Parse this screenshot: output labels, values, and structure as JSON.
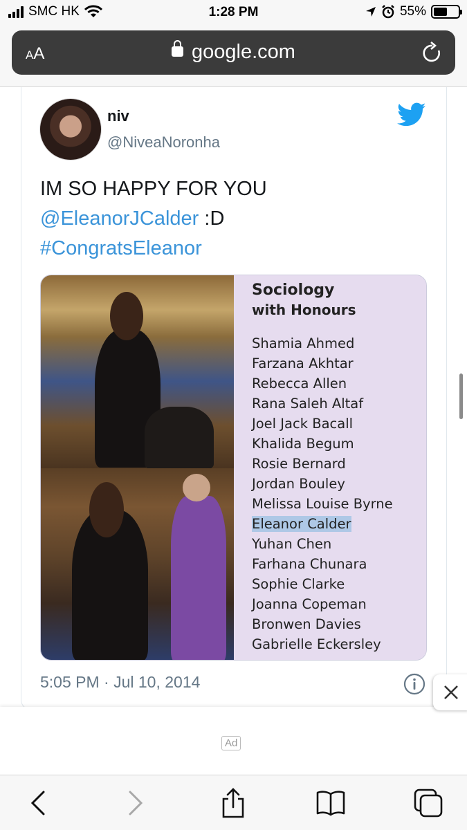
{
  "status_bar": {
    "carrier": "SMC HK",
    "time": "1:28 PM",
    "battery": "55%",
    "battery_level": 0.55,
    "icons": [
      "signal-icon",
      "wifi-icon",
      "location-arrow-icon",
      "alarm-icon",
      "battery-icon"
    ]
  },
  "browser": {
    "text_size_label": "AA",
    "url": "google.com",
    "reload_icon": "reload-icon",
    "lock_icon": "lock-icon"
  },
  "tweet": {
    "display_name": "niv",
    "handle": "@NiveaNoronha",
    "text_plain": "IM SO HAPPY FOR YOU",
    "mention": "@EleanorJCalder",
    "text_suffix": " :D",
    "hashtag": "#CongratsEleanor",
    "timestamp": "5:05 PM · Jul 10, 2014",
    "logo_icon": "twitter-bird-icon",
    "info_icon": "info-icon",
    "media": {
      "list_title": "Sociology",
      "list_subtitle": "with Honours",
      "names": [
        "Shamia Ahmed",
        "Farzana Akhtar",
        "Rebecca Allen",
        "Rana Saleh Altaf",
        "Joel Jack Bacall",
        "Khalida Begum",
        "Rosie Bernard",
        "Jordan Bouley",
        "Melissa Louise Byrne",
        "Eleanor Calder",
        "Yuhan Chen",
        "Farhana Chunara",
        "Sophie Clarke",
        "Joanna Copeman",
        "Bronwen Davies",
        "Gabrielle Eckersley"
      ],
      "highlighted_name": "Eleanor Calder"
    }
  },
  "ad": {
    "label": "Ad",
    "close_icon": "close-icon"
  },
  "toolbar": {
    "icons": [
      "back-icon",
      "forward-icon",
      "share-icon",
      "bookmarks-icon",
      "tabs-icon"
    ]
  },
  "colors": {
    "link": "#3b94d9",
    "handle": "#657786",
    "highlight": "#aec8e6",
    "url_bar": "#3b3b3b"
  }
}
